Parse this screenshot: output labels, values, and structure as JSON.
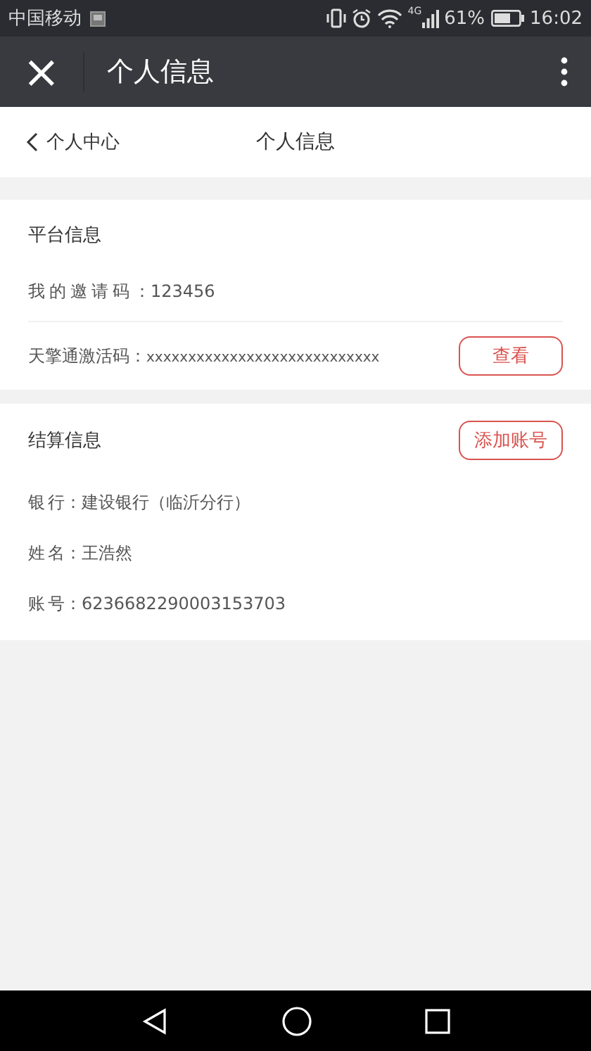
{
  "status_bar": {
    "carrier": "中国移动",
    "network": "4G",
    "battery": "61%",
    "time": "16:02"
  },
  "app_bar": {
    "close": "×",
    "title": "个人信息"
  },
  "header": {
    "back": "个人中心",
    "title": "个人信息"
  },
  "platform": {
    "title": "平台信息",
    "invite": {
      "label": "我的邀请码",
      "value": "：123456"
    },
    "activation": {
      "label": "天擎通激活码：",
      "value": "xxxxxxxxxxxxxxxxxxxxxxxxxxxx",
      "button": "查看"
    }
  },
  "settlement": {
    "title": "结算信息",
    "button": "添加账号",
    "rows": [
      {
        "label": "银行",
        "value": "：建设银行（临沂分行）"
      },
      {
        "label": "姓名",
        "value": "：王浩然"
      },
      {
        "label": "账号",
        "value": "：6236682290003153703"
      }
    ]
  }
}
